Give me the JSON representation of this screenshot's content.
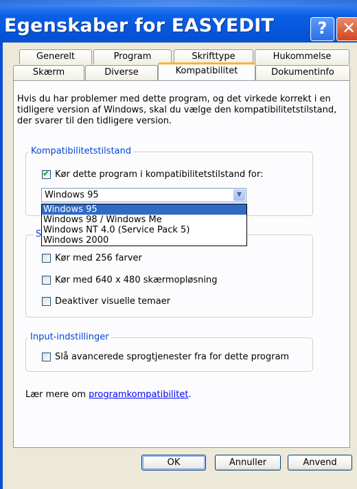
{
  "window": {
    "title": "Egenskaber for EASYEDIT",
    "help_label": "?",
    "close_label": "✕"
  },
  "tabs": {
    "row1": [
      "Generelt",
      "Program",
      "Skrifttype",
      "Hukommelse"
    ],
    "row2": [
      "Skærm",
      "Diverse",
      "Kompatibilitet",
      "Dokumentinfo"
    ],
    "active": "Kompatibilitet"
  },
  "description": "Hvis du har problemer med dette program, og det virkede korrekt i en tidligere version af Windows, skal du vælge den kompatibilitetstilstand, der svarer til den tidligere version.",
  "compat_group": {
    "legend": "Kompatibilitetstilstand",
    "checkbox_label": "Kør dette program i kompatibilitetstilstand for:",
    "checked": true,
    "selected": "Windows 95",
    "options": [
      "Windows 95",
      "Windows 98 / Windows Me",
      "Windows NT 4.0 (Service Pack 5)",
      "Windows 2000"
    ]
  },
  "display_group": {
    "legend_visible": "S",
    "items": [
      {
        "label": "Kør med 256 farver",
        "checked": false
      },
      {
        "label": "Kør med 640 x 480 skærmopløsning",
        "checked": false
      },
      {
        "label": "Deaktiver visuelle temaer",
        "checked": false
      }
    ]
  },
  "input_group": {
    "legend": "Input-indstillinger",
    "checkbox_label": "Slå avancerede sprogtjenester fra for dette program",
    "checked": false
  },
  "learn_more": {
    "prefix": "Lær mere om ",
    "link": "programkompatibilitet",
    "suffix": "."
  },
  "buttons": {
    "ok": "OK",
    "cancel": "Annuller",
    "apply": "Anvend"
  },
  "colors": {
    "titlebar": "#0552D6",
    "group_legend": "#0046D5",
    "selection": "#316AC5",
    "active_tab_accent": "#F8B436"
  }
}
